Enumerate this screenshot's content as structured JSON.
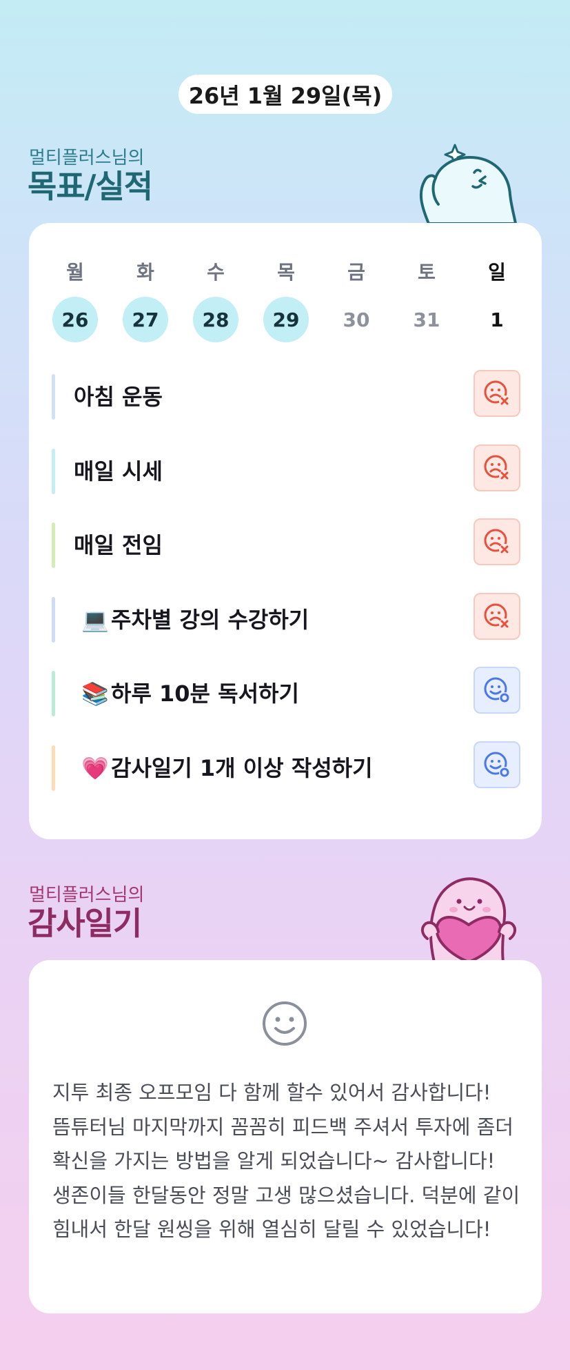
{
  "date_label": "26년 1월 29일(목)",
  "goals_section": {
    "subtitle": "멀티플러스님의",
    "title": "목표/실적"
  },
  "week": [
    {
      "day": "월",
      "num": "26",
      "done": true
    },
    {
      "day": "화",
      "num": "27",
      "done": true
    },
    {
      "day": "수",
      "num": "28",
      "done": true
    },
    {
      "day": "목",
      "num": "29",
      "done": true
    },
    {
      "day": "금",
      "num": "30",
      "done": false
    },
    {
      "day": "토",
      "num": "31",
      "done": false
    },
    {
      "day": "일",
      "num": "1",
      "done": false
    }
  ],
  "goals": [
    {
      "label": "아침 운동",
      "icon": "",
      "bar_color": "#cfe0f7",
      "status": "fail"
    },
    {
      "label": "매일 시세",
      "icon": "",
      "bar_color": "#c3eef2",
      "status": "fail"
    },
    {
      "label": "매일 전임",
      "icon": "",
      "bar_color": "#d3edb5",
      "status": "fail"
    },
    {
      "label": "주차별 강의 수강하기",
      "icon": "💻",
      "bar_color": "#cfdcf7",
      "status": "fail"
    },
    {
      "label": "하루 10분 독서하기",
      "icon": "📚",
      "bar_color": "#b9ecd6",
      "status": "ok"
    },
    {
      "label": "감사일기 1개 이상 작성하기",
      "icon": "💗",
      "bar_color": "#fddbb4",
      "status": "ok"
    }
  ],
  "gratitude_section": {
    "subtitle": "멀티플러스님의",
    "title": "감사일기",
    "text": "지투 최종 오프모임 다 함께 할수 있어서 감사합니다! 뜸튜터님 마지막까지 꼼꼼히 피드백 주셔서 투자에 좀더 확신을 가지는 방법을 알게 되었습니다~ 감사합니다! 생존이들 한달동안 정말 고생 많으셨습니다. 덕분에 같이 힘내서 한달 원씽을 위해 열심히 달릴 수 있었습니다!"
  },
  "colors": {
    "teal": "#2b7d8c",
    "plum": "#a3366f",
    "fail": "#e8503a",
    "ok": "#4a78e6"
  }
}
